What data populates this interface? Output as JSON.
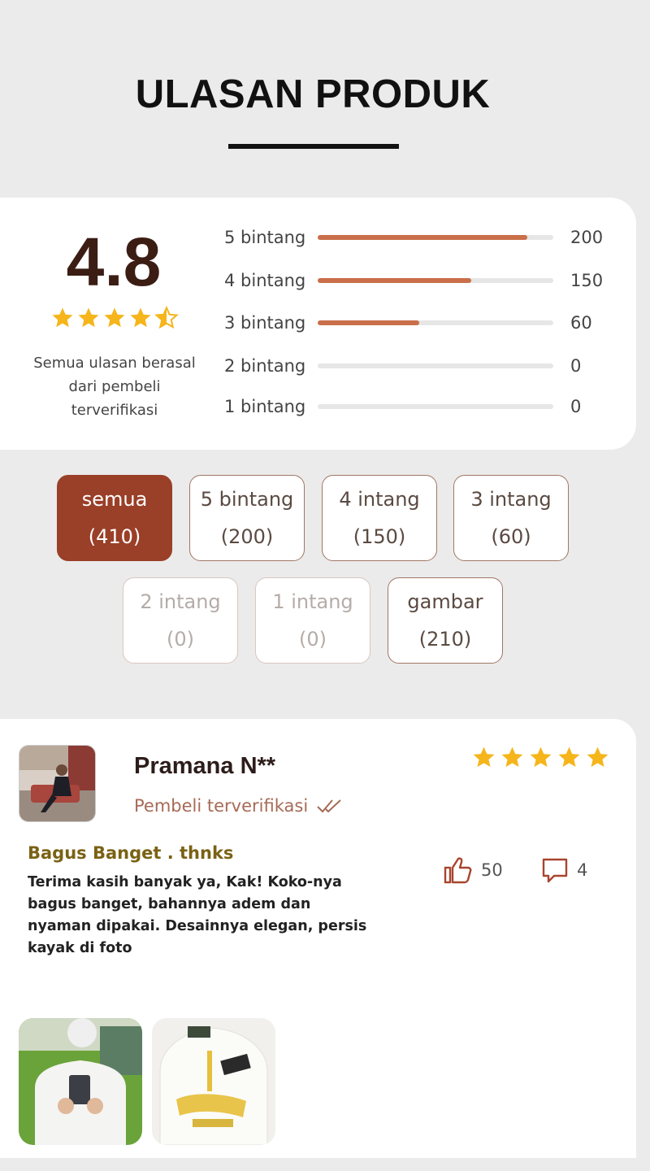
{
  "header": {
    "title": "ULASAN PRODUK"
  },
  "summary": {
    "average": "4.8",
    "average_value": 4.8,
    "star_color": "#f5b51b",
    "note": "Semua ulasan berasal dari pembeli terverifikasi",
    "rows": [
      {
        "label": "5 bintang",
        "count": "200",
        "fraction": 0.89
      },
      {
        "label": "4 bintang",
        "count": "150",
        "fraction": 0.65
      },
      {
        "label": "3 bintang",
        "count": "60",
        "fraction": 0.43
      },
      {
        "label": "2 bintang",
        "count": "0",
        "fraction": 0
      },
      {
        "label": "1 bintang",
        "count": "0",
        "fraction": 0
      }
    ],
    "bar_color": "#c96f4a"
  },
  "filters": [
    {
      "label": "semua",
      "count": "(410)",
      "state": "active"
    },
    {
      "label": "5 bintang",
      "count": "(200)",
      "state": "normal"
    },
    {
      "label": "4 intang",
      "count": "(150)",
      "state": "normal"
    },
    {
      "label": "3 intang",
      "count": "(60)",
      "state": "normal"
    },
    {
      "label": "2 intang",
      "count": "(0)",
      "state": "disabled"
    },
    {
      "label": "1 intang",
      "count": "(0)",
      "state": "disabled"
    },
    {
      "label": "gambar",
      "count": "(210)",
      "state": "normal"
    }
  ],
  "review": {
    "name": "Pramana N**",
    "verified_label": "Pembeli terverifikasi",
    "rating": 5,
    "title": "Bagus Banget . thnks",
    "body": "Terima kasih banyak ya, Kak! Koko-nya bagus banget, bahannya adem dan nyaman dipakai. Desainnya elegan, persis kayak di foto",
    "likes": "50",
    "comments": "4"
  }
}
